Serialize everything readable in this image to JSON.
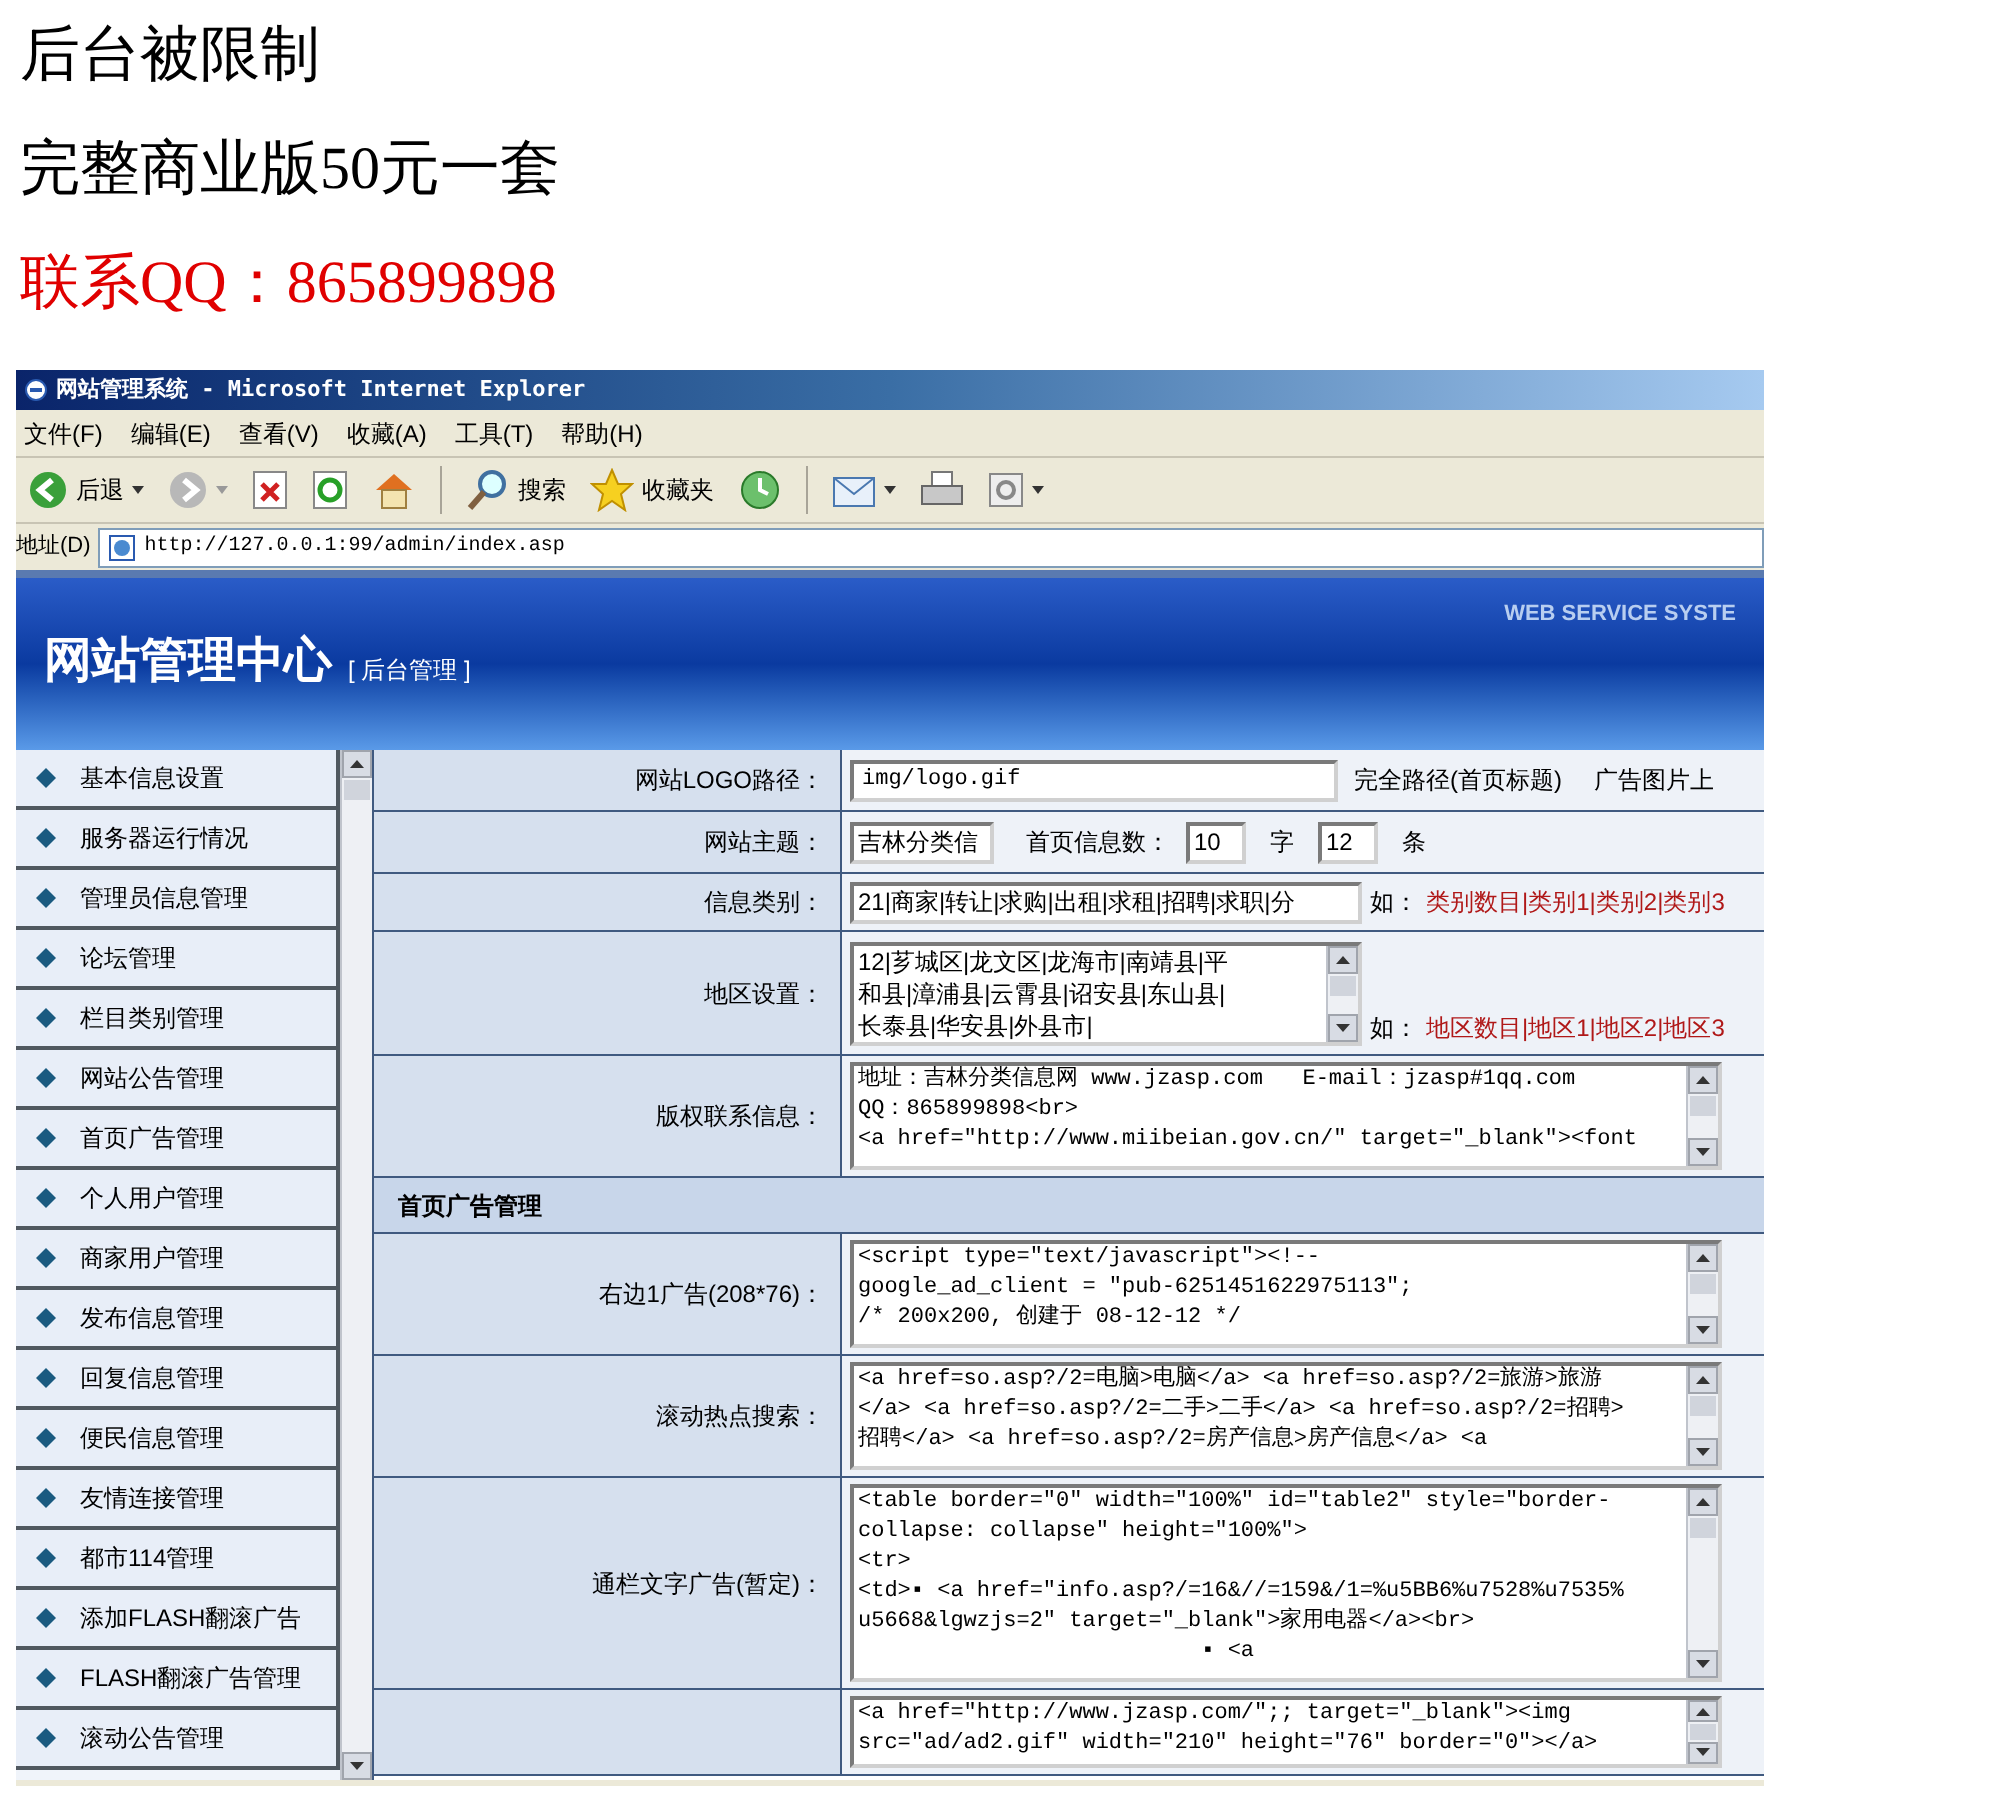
{
  "headings": [
    {
      "text": "后台被限制",
      "kind": "plain"
    },
    {
      "text": "完整商业版50元一套",
      "kind": "plain"
    },
    {
      "text": "联系QQ：865899898",
      "kind": "contact"
    }
  ],
  "browser": {
    "title": "网站管理系统 - Microsoft Internet Explorer",
    "menu": [
      "文件(F)",
      "编辑(E)",
      "查看(V)",
      "收藏(A)",
      "工具(T)",
      "帮助(H)"
    ],
    "toolbar": {
      "back": "后退",
      "search": "搜索",
      "favorites": "收藏夹"
    },
    "address_label": "地址(D)",
    "url": "http://127.0.0.1:99/admin/index.asp"
  },
  "banner": {
    "title": "网站管理中心",
    "subtitle": "[ 后台管理 ]",
    "tagline": "WEB SERVICE SYSTE"
  },
  "sidebar": {
    "items": [
      "基本信息设置",
      "服务器运行情况",
      "管理员信息管理",
      "论坛管理",
      "栏目类别管理",
      "网站公告管理",
      "首页广告管理",
      "个人用户管理",
      "商家用户管理",
      "发布信息管理",
      "回复信息管理",
      "便民信息管理",
      "友情连接管理",
      "都市114管理",
      "添加FLASH翻滚广告",
      "FLASH翻滚广告管理",
      "滚动公告管理"
    ]
  },
  "form": [
    {
      "kind": "input",
      "label": "网站LOGO路径：",
      "value": "img/logo.gif",
      "notes": [
        "完全路径(首页标题)",
        "广告图片上"
      ]
    },
    {
      "kind": "theme",
      "label": "网站主题：",
      "value": "吉林分类信",
      "count_label": "首页信息数：",
      "count1": "10",
      "unit1": "字",
      "count2": "12",
      "unit2": "条"
    },
    {
      "kind": "category",
      "label": "信息类别：",
      "value": "21|商家|转让|求购|出租|求租|招聘|求职|分",
      "hint": "如：",
      "example": "类别数目|类别1|类别2|类别3"
    },
    {
      "kind": "region",
      "label": "地区设置：",
      "lines": [
        "12|芗城区|龙文区|龙海市|南靖县|平",
        "和县|漳浦县|云霄县|诏安县|东山县|",
        "长泰县|华安县|外县市|"
      ],
      "hint": "如：",
      "example": "地区数目|地区1|地区2|地区3"
    },
    {
      "kind": "textarea",
      "label": "版权联系信息：",
      "lines": [
        "地址：吉林分类信息网 www.jzasp.com   E-mail：jzasp#1qq.com",
        "QQ：865899898<br>",
        "<a href=\"http://www.miibeian.gov.cn/\" target=\"_blank\"><font"
      ]
    },
    {
      "kind": "section",
      "label": "首页广告管理"
    },
    {
      "kind": "textarea",
      "label": "右边1广告(208*76)：",
      "lines": [
        "<script type=\"text/javascript\"><!--",
        "google_ad_client = \"pub-6251451622975113\";",
        "/* 200x200, 创建于 08-12-12 */"
      ]
    },
    {
      "kind": "textarea",
      "label": "滚动热点搜索：",
      "lines": [
        "<a href=so.asp?/2=电脑>电脑</a> <a href=so.asp?/2=旅游>旅游",
        "</a> <a href=so.asp?/2=二手>二手</a> <a href=so.asp?/2=招聘>",
        "招聘</a> <a href=so.asp?/2=房产信息>房产信息</a> <a"
      ]
    },
    {
      "kind": "textarea",
      "label": "通栏文字广告(暂定)：",
      "lines": [
        "<table border=\"0\" width=\"100%\" id=\"table2\" style=\"border-",
        "collapse: collapse\" height=\"100%\">",
        "<tr>",
        "<td>▪ <a href=\"info.asp?/=16&//=159&/1=%u5BB6%u7528%u7535%",
        "u5668&lgwzjs=2\" target=\"_blank\">家用电器</a><br>",
        "                          ▪ <a"
      ]
    },
    {
      "kind": "textarea",
      "lines": [
        "<a href=\"http://www.jzasp.com/\";; target=\"_blank\"><img",
        "src=\"ad/ad2.gif\" width=\"210\" height=\"76\" border=\"0\"></a>"
      ]
    }
  ]
}
